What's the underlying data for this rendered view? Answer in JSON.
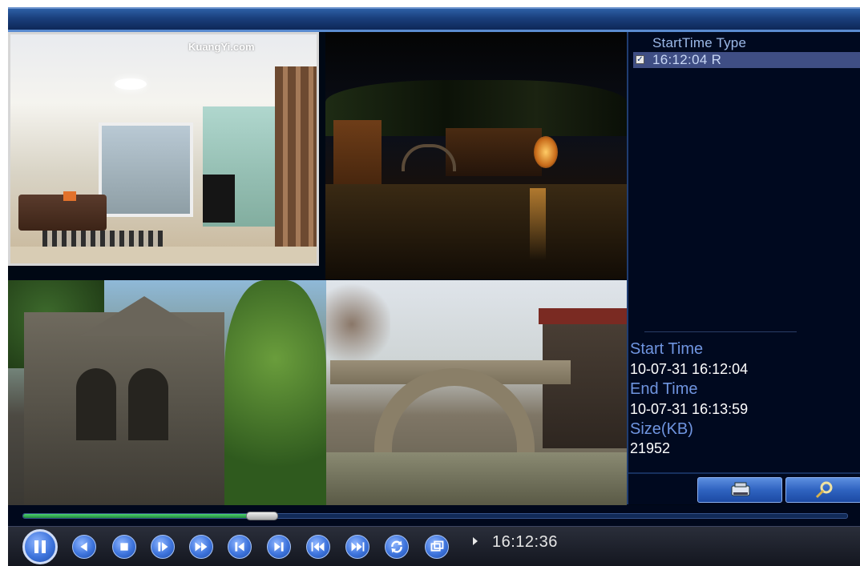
{
  "video_cells": [
    {
      "id": 1,
      "scene": "interior living room",
      "watermark": "KuangYi.com"
    },
    {
      "id": 2,
      "scene": "night canal town"
    },
    {
      "id": 3,
      "scene": "gothic building with tree"
    },
    {
      "id": 4,
      "scene": "stone arch bridge"
    }
  ],
  "record_list": {
    "header": "StartTime Type",
    "rows": [
      {
        "checked": true,
        "text": "16:12:04  R"
      }
    ]
  },
  "record_info": {
    "start_time_label": "Start Time",
    "start_time_value": "10-07-31 16:12:04",
    "end_time_label": "End Time",
    "end_time_value": "10-07-31 16:13:59",
    "size_label": "Size(KB)",
    "size_value": "21952"
  },
  "panel_buttons": [
    {
      "icon": "backup-icon"
    },
    {
      "icon": "search-icon"
    }
  ],
  "playback": {
    "progress": 0.29,
    "current_time": "16:12:36",
    "controls": [
      "pause",
      "reverse-play",
      "stop",
      "step-forward",
      "fast-forward",
      "previous-frame",
      "next-frame",
      "previous-file",
      "next-file",
      "loop",
      "fullscreen"
    ]
  },
  "colors": {
    "background": "#000814",
    "accent_blue": "#3e74dc",
    "label_blue": "#6f95e0",
    "progress_green": "#4fd16f"
  }
}
